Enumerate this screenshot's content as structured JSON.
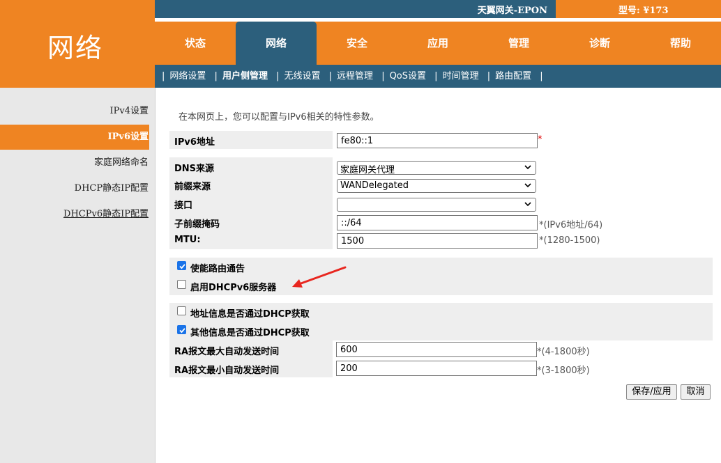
{
  "header": {
    "logo_text": "网络",
    "device_name": "天翼网关-EPON",
    "model_label": "型号: ¥173"
  },
  "nav": {
    "tabs": [
      {
        "label": "状态",
        "active": false
      },
      {
        "label": "网络",
        "active": true
      },
      {
        "label": "安全",
        "active": false
      },
      {
        "label": "应用",
        "active": false
      },
      {
        "label": "管理",
        "active": false
      },
      {
        "label": "诊断",
        "active": false
      },
      {
        "label": "帮助",
        "active": false
      }
    ]
  },
  "subnav": {
    "items": [
      {
        "label": "网络设置",
        "active": false
      },
      {
        "label": "用户侧管理",
        "active": true
      },
      {
        "label": "无线设置",
        "active": false
      },
      {
        "label": "远程管理",
        "active": false
      },
      {
        "label": "QoS设置",
        "active": false
      },
      {
        "label": "时间管理",
        "active": false
      },
      {
        "label": "路由配置",
        "active": false
      }
    ],
    "separator": "|"
  },
  "sidebar": {
    "items": [
      {
        "label": "IPv4设置"
      },
      {
        "label": "IPv6设置"
      },
      {
        "label": "家庭网络命名"
      },
      {
        "label": "DHCP静态IP配置"
      },
      {
        "label": "DHCPv6静态IP配置"
      }
    ]
  },
  "main": {
    "intro": "在本网页上，您可以配置与IPv6相关的特性参数。",
    "ipv6_address": {
      "label": "IPv6地址",
      "value": "fe80::1",
      "required_mark": "*"
    },
    "dns_source": {
      "label": "DNS来源",
      "value": "家庭网关代理"
    },
    "prefix_source": {
      "label": "前缀来源",
      "value": "WANDelegated"
    },
    "interface": {
      "label": "接口",
      "value": ""
    },
    "subnet_mask": {
      "label": "子前缀掩码",
      "value": "::/64",
      "hint": "*(IPv6地址/64)"
    },
    "mtu": {
      "label": "MTU:",
      "value": "1500",
      "hint": "*(1280-1500)"
    },
    "enable_ra": {
      "label": "使能路由通告",
      "checked": true
    },
    "enable_dhcpv6": {
      "label": "启用DHCPv6服务器",
      "checked": false
    },
    "addr_via_dhcp": {
      "label": "地址信息是否通过DHCP获取",
      "checked": false
    },
    "other_via_dhcp": {
      "label": "其他信息是否通过DHCP获取",
      "checked": true
    },
    "ra_max": {
      "label": "RA报文最大自动发送时间",
      "value": "600",
      "hint": "*(4-1800秒)"
    },
    "ra_min": {
      "label": "RA报文最小自动发送时间",
      "value": "200",
      "hint": "*(3-1800秒)"
    },
    "save_button": "保存/应用",
    "cancel_button": "取消"
  },
  "colors": {
    "orange": "#ef8422",
    "dark_blue": "#2c5f7c",
    "checkbox_blue": "#1a73e8",
    "arrow_red": "#e8261f"
  }
}
